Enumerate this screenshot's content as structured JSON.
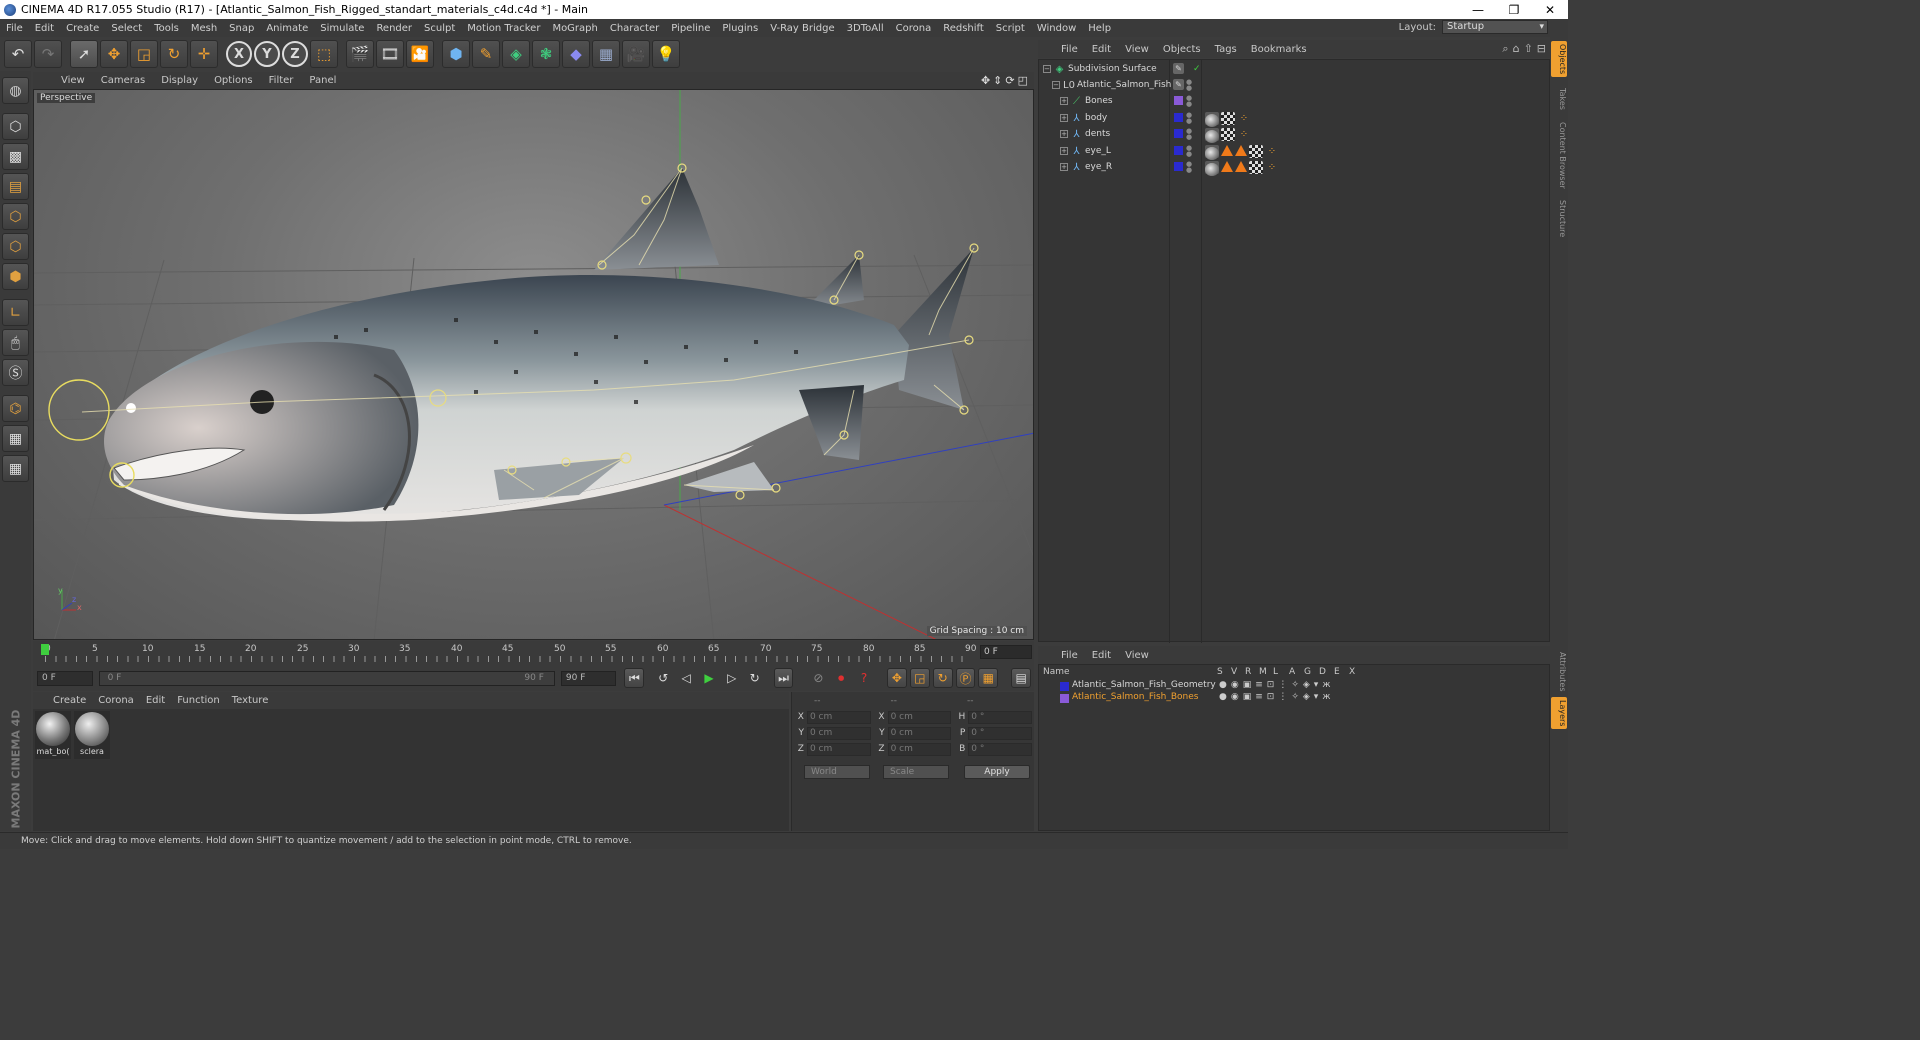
{
  "window": {
    "title": "CINEMA 4D R17.055 Studio (R17) - [Atlantic_Salmon_Fish_Rigged_standart_materials_c4d.c4d *] - Main",
    "minimize": "—",
    "restore": "❐",
    "close": "✕"
  },
  "menubar": {
    "items": [
      "File",
      "Edit",
      "Create",
      "Select",
      "Tools",
      "Mesh",
      "Snap",
      "Animate",
      "Simulate",
      "Render",
      "Sculpt",
      "Motion Tracker",
      "MoGraph",
      "Character",
      "Pipeline",
      "Plugins",
      "V-Ray Bridge",
      "3DToAll",
      "Corona",
      "Redshift",
      "Script",
      "Window",
      "Help"
    ],
    "layout_label": "Layout:",
    "layout_value": "Startup"
  },
  "toolbar": {
    "undo": "↶",
    "redo": "↷",
    "axis_x": "X",
    "axis_y": "Y",
    "axis_z": "Z"
  },
  "viewport": {
    "menu": [
      "View",
      "Cameras",
      "Display",
      "Options",
      "Filter",
      "Panel"
    ],
    "camera_label": "Perspective",
    "grid_spacing": "Grid Spacing : 10 cm",
    "axis_x": "x",
    "axis_y": "y",
    "axis_z": "z"
  },
  "timeline": {
    "ticks": [
      "0",
      "5",
      "10",
      "15",
      "20",
      "25",
      "30",
      "35",
      "40",
      "45",
      "50",
      "55",
      "60",
      "65",
      "70",
      "75",
      "80",
      "85",
      "90"
    ],
    "end_frame": "0 F",
    "current_frame": "0 F",
    "range_start": "0 F",
    "range_end": "90 F",
    "max_frame": "90 F"
  },
  "materials": {
    "menu": [
      "Create",
      "Corona",
      "Edit",
      "Function",
      "Texture"
    ],
    "items": [
      {
        "name": "mat_bo("
      },
      {
        "name": "sclera"
      }
    ]
  },
  "coords": {
    "header": [
      "--",
      "--",
      "--"
    ],
    "rows": [
      {
        "a1": "X",
        "v1": "0 cm",
        "a2": "X",
        "v2": "0 cm",
        "a3": "H",
        "v3": "0 °"
      },
      {
        "a1": "Y",
        "v1": "0 cm",
        "a2": "Y",
        "v2": "0 cm",
        "a3": "P",
        "v3": "0 °"
      },
      {
        "a1": "Z",
        "v1": "0 cm",
        "a2": "Z",
        "v2": "0 cm",
        "a3": "B",
        "v3": "0 °"
      }
    ],
    "space": "World",
    "mode": "Scale",
    "apply": "Apply"
  },
  "status": {
    "text": "Move: Click and drag to move elements. Hold down SHIFT to quantize movement / add to the selection in point mode, CTRL to remove."
  },
  "objects": {
    "menu": [
      "File",
      "Edit",
      "View",
      "Objects",
      "Tags",
      "Bookmarks"
    ],
    "rows": [
      {
        "name": "Subdivision Surface",
        "color": "#c8c8c8"
      },
      {
        "name": "Atlantic_Salmon_Fish",
        "color": "#c8c8c8"
      },
      {
        "name": "Bones",
        "color": "#8a5ad8"
      },
      {
        "name": "body",
        "color": "#2a2ad0"
      },
      {
        "name": "dents",
        "color": "#2a2ad0"
      },
      {
        "name": "eye_L",
        "color": "#2a2ad0"
      },
      {
        "name": "eye_R",
        "color": "#2a2ad0"
      }
    ]
  },
  "layers": {
    "menu": [
      "File",
      "Edit",
      "View"
    ],
    "columns": [
      "Name",
      "S",
      "V",
      "R",
      "M",
      "L",
      "A",
      "G",
      "D",
      "E",
      "X"
    ],
    "rows": [
      {
        "name": "Atlantic_Salmon_Fish_Geometry",
        "color": "#2a2ad0",
        "text_color": "#d8d8d8"
      },
      {
        "name": "Atlantic_Salmon_Fish_Bones",
        "color": "#8a5ad8",
        "text_color": "#f0a030"
      }
    ]
  },
  "right_tabs": [
    "Objects",
    "Takes",
    "Content Browser",
    "Structure",
    "Attributes",
    "Layers"
  ],
  "brand": "MAXON CINEMA 4D",
  "colors": {
    "accent": "#f0a030",
    "timeline_marker": "#3fcf3f",
    "layer_geometry": "#2a2ad0",
    "layer_bones": "#8a5ad8"
  }
}
